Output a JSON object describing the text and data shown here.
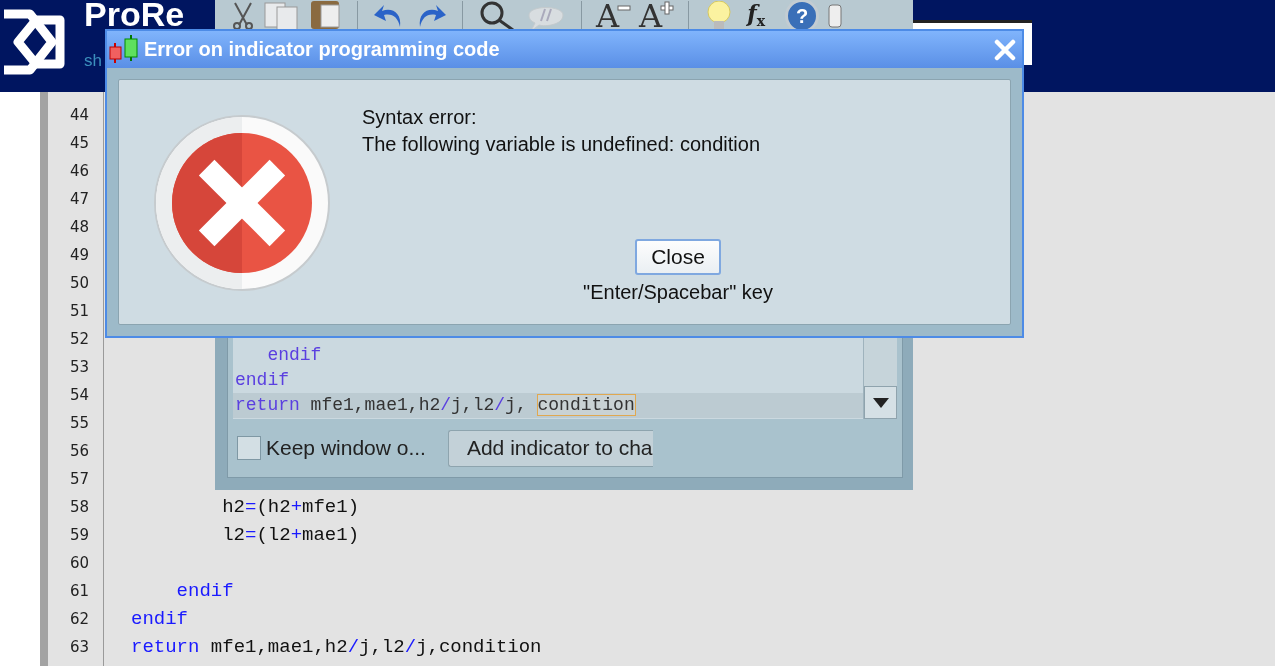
{
  "site_header": {
    "logo_text": "ProRe",
    "tagline": "sh"
  },
  "code_editor": {
    "rows": [
      {
        "number": "44"
      },
      {
        "number": "45"
      },
      {
        "number": "46"
      },
      {
        "number": "47"
      },
      {
        "number": "48"
      },
      {
        "number": "49"
      },
      {
        "number": "50"
      },
      {
        "number": "51"
      },
      {
        "number": "52"
      },
      {
        "number": "53"
      },
      {
        "number": "54"
      },
      {
        "number": "55"
      },
      {
        "number": "56"
      },
      {
        "number": "57"
      },
      {
        "number": "58",
        "code": [
          {
            "text": "        h2",
            "kind": "ident"
          },
          {
            "text": "=",
            "kind": "op"
          },
          {
            "text": "(h2",
            "kind": "ident"
          },
          {
            "text": "+",
            "kind": "op"
          },
          {
            "text": "mfe1)",
            "kind": "ident"
          }
        ]
      },
      {
        "number": "59",
        "code": [
          {
            "text": "        l2",
            "kind": "ident"
          },
          {
            "text": "=",
            "kind": "op"
          },
          {
            "text": "(l2",
            "kind": "ident"
          },
          {
            "text": "+",
            "kind": "op"
          },
          {
            "text": "mae1)",
            "kind": "ident"
          }
        ]
      },
      {
        "number": "60"
      },
      {
        "number": "61",
        "code": [
          {
            "text": "    endif",
            "kind": "keyword"
          }
        ]
      },
      {
        "number": "62",
        "code": [
          {
            "text": "endif",
            "kind": "keyword"
          }
        ]
      },
      {
        "number": "63",
        "code": [
          {
            "text": "return",
            "kind": "keyword"
          },
          {
            "text": " mfe1,mae1,h2",
            "kind": "ident"
          },
          {
            "text": "/",
            "kind": "op"
          },
          {
            "text": "j,l2",
            "kind": "ident"
          },
          {
            "text": "/",
            "kind": "op"
          },
          {
            "text": "j,condition",
            "kind": "ident"
          }
        ]
      }
    ]
  },
  "indicator_window": {
    "toolbar": [
      {
        "kind": "scissors"
      },
      {
        "kind": "copy"
      },
      {
        "kind": "paste"
      },
      {
        "kind": "separator"
      },
      {
        "kind": "undo"
      },
      {
        "kind": "redo"
      },
      {
        "kind": "separator"
      },
      {
        "kind": "search"
      },
      {
        "kind": "bubble"
      },
      {
        "kind": "separator"
      },
      {
        "kind": "text_smaller",
        "glyph": "A"
      },
      {
        "kind": "text_larger",
        "glyph": "A"
      },
      {
        "kind": "separator"
      },
      {
        "kind": "bulb"
      },
      {
        "kind": "function",
        "glyph": "f",
        "sub": "x"
      },
      {
        "kind": "help",
        "glyph": "?"
      },
      {
        "kind": "cylinder"
      }
    ],
    "code_lines": [
      {
        "selected": false,
        "tokens": [
          {
            "text": "   endif",
            "kind": "keyword"
          }
        ]
      },
      {
        "selected": false,
        "tokens": [
          {
            "text": "endif",
            "kind": "keyword"
          }
        ]
      },
      {
        "selected": true,
        "tokens": [
          {
            "text": "return",
            "kind": "keyword"
          },
          {
            "text": " mfe1,mae1,h2",
            "kind": "ident"
          },
          {
            "text": "/",
            "kind": "op"
          },
          {
            "text": "j,l2",
            "kind": "ident"
          },
          {
            "text": "/",
            "kind": "op"
          },
          {
            "text": "j, ",
            "kind": "ident"
          },
          {
            "text": "condition",
            "kind": "error"
          }
        ]
      }
    ],
    "keep_window": {
      "label": "Keep window o...",
      "checked": false
    },
    "add_button": "Add indicator to cha"
  },
  "error_dialog": {
    "title": "Error on indicator programming code",
    "message": [
      "Syntax error:",
      "The following variable is undefined: condition"
    ],
    "close_button": "Close",
    "hint": "\"Enter/Spacebar\" key"
  }
}
